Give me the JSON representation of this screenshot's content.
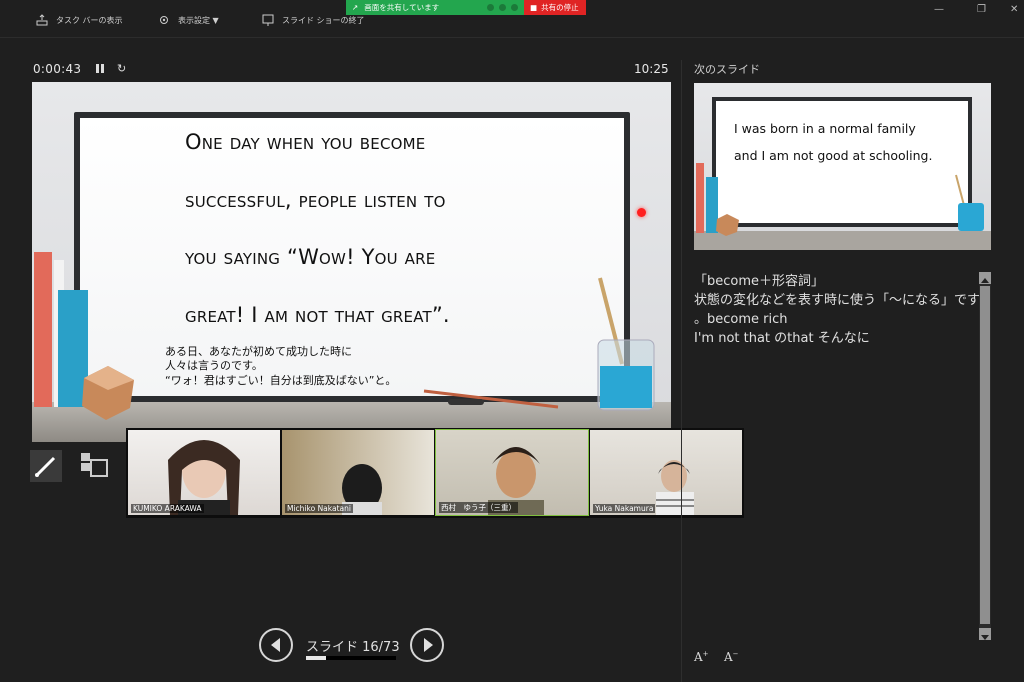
{
  "toolbar": {
    "taskbar_label": "タスク バーの表示",
    "display_settings_label": "表示設定 ▼",
    "end_show_label": "スライド ショーの終了"
  },
  "share_banner": {
    "sharing_text": "画面を共有しています",
    "stop_label": "共有の停止"
  },
  "presenter": {
    "elapsed_time": "0:00:43",
    "clock": "10:25"
  },
  "current_slide": {
    "lines": [
      "One day when you become",
      "successful, people listen to",
      "you saying “Wow! You are",
      "great! I am not that great”."
    ],
    "jp_lines": [
      "ある日、あなたが初めて成功した時に",
      "人々は言うのです。",
      "“ワォ！君はすごい！自分は到底及ばない”と。"
    ]
  },
  "participants": [
    {
      "name": "KUMIKO ARAKAWA"
    },
    {
      "name": "Michiko Nakatani"
    },
    {
      "name": "西村　ゆう子（三重）"
    },
    {
      "name": "Yuka Nakamura"
    }
  ],
  "navigation": {
    "counter": "スライド 16/73",
    "progress": 0.219
  },
  "next_slide": {
    "label": "次のスライド",
    "lines": [
      "I was born in a normal family",
      "and I am not good at schooling."
    ]
  },
  "notes": {
    "lines": [
      "「become＋形容詞」",
      "状態の変化などを表す時に使う「～になる」です",
      "。become rich",
      "I'm not that のthat そんなに"
    ]
  },
  "colors": {
    "background": "#1f1f1f",
    "share_green": "#23a64e",
    "share_red": "#e02424",
    "active_speaker": "#7fbf3f"
  }
}
